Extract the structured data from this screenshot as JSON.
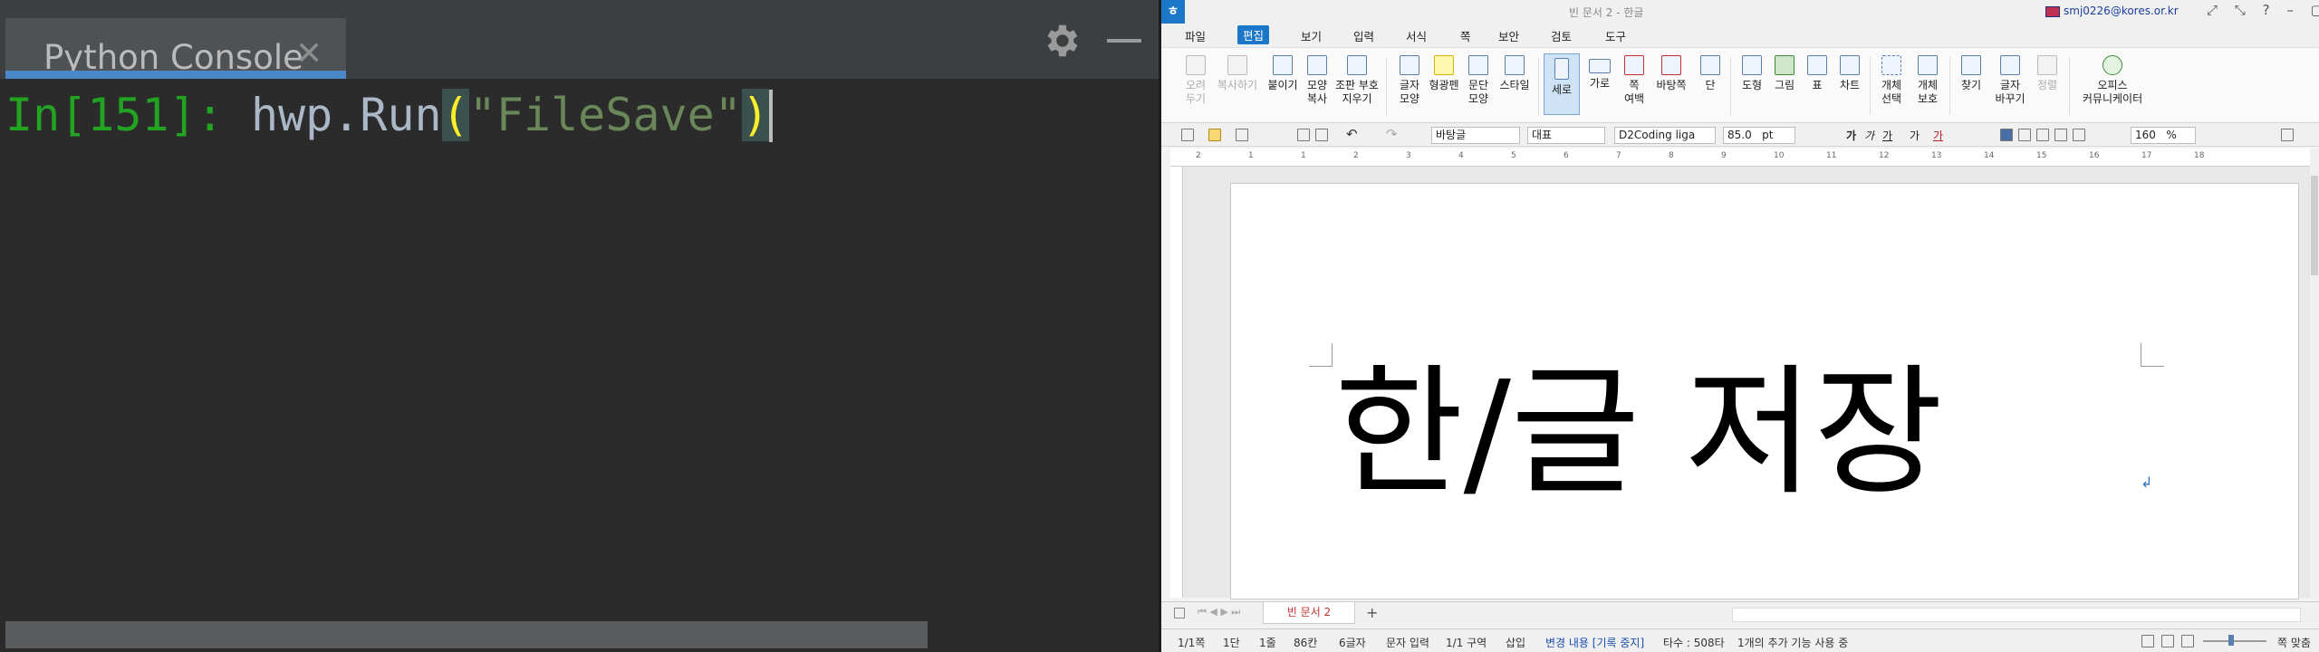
{
  "console": {
    "tab_title": "Python Console",
    "close_glyph": "✕",
    "prompt": "In[151]: ",
    "code_prefix": "hwp.Run",
    "open_paren": "(",
    "string_literal": "\"FileSave\"",
    "close_paren": ")",
    "icons": [
      "settings-gear-icon",
      "minimize-icon",
      "close-icon"
    ],
    "colors": {
      "background": "#2b2b2b",
      "prompt": "#22a322",
      "string": "#6a8759",
      "paren": "#ffef28",
      "tab_underline": "#4a88c7"
    }
  },
  "hwp": {
    "window_title": "빈 문서 2 - 한글",
    "user_email": "smj0226@kores.or.kr",
    "logo_glyph": "ㅎ",
    "window_controls": [
      "⤢",
      "⤡",
      "?",
      "–",
      "▢",
      "✕"
    ],
    "menu": [
      "파일",
      "편집",
      "보기",
      "입력",
      "서식",
      "쪽",
      "보안",
      "검토",
      "도구"
    ],
    "active_menu": "편집",
    "ribbon": {
      "cut": [
        "오려",
        "두기"
      ],
      "copy": "복사하기",
      "paste": "붙이기",
      "shape_copy": [
        "모양",
        "복사"
      ],
      "compose": [
        "조판 부호",
        "지우기"
      ],
      "char_shape": [
        "글자",
        "모양"
      ],
      "highlight": "형광펜",
      "para_shape": [
        "문단",
        "모양"
      ],
      "style": "스타일",
      "vertical": "세로",
      "horizontal": "가로",
      "page_margin": [
        "쪽",
        "여백"
      ],
      "background": "바탕쪽",
      "columns": "단",
      "drawing": "도형",
      "picture": "그림",
      "table": "표",
      "chart": "차트",
      "object_select": [
        "개체",
        "선택"
      ],
      "object_protect": [
        "개체",
        "보호"
      ],
      "find": "찾기",
      "replace_char": [
        "글자",
        "바꾸기"
      ],
      "sort": "정렬",
      "office_community": [
        "오피스",
        "커뮤니케이터"
      ]
    },
    "format_bar": {
      "style": "바탕글",
      "font_group": "대표",
      "font_name": "D2Coding liga",
      "font_size": "85.0",
      "size_unit": "pt",
      "char_buttons": [
        "가",
        "가",
        "가",
        "가",
        "가"
      ],
      "zoom": "160",
      "zoom_unit": "%"
    },
    "ruler_marks": [
      "2",
      "1",
      "1",
      "2",
      "3",
      "4",
      "5",
      "6",
      "7",
      "8",
      "9",
      "10",
      "11",
      "12",
      "13",
      "14",
      "15",
      "16",
      "17",
      "18"
    ],
    "document_text": "한/글 저장",
    "paragraph_mark": "↲",
    "doc_tab": "빈 문서 2",
    "add_tab": "+",
    "status": {
      "page": "1/1쪽",
      "column": "1단",
      "line": "1줄",
      "char": "86칸",
      "count": "6글자",
      "mode": "문자 입력",
      "section": "1/1 구역",
      "insert": "삽입",
      "track": "변경 내용 [기록 중지]",
      "typing": "타수 : 508타",
      "addons": "1개의 추가 기능 사용 중",
      "zoom_label": "쪽 맞춤"
    }
  }
}
